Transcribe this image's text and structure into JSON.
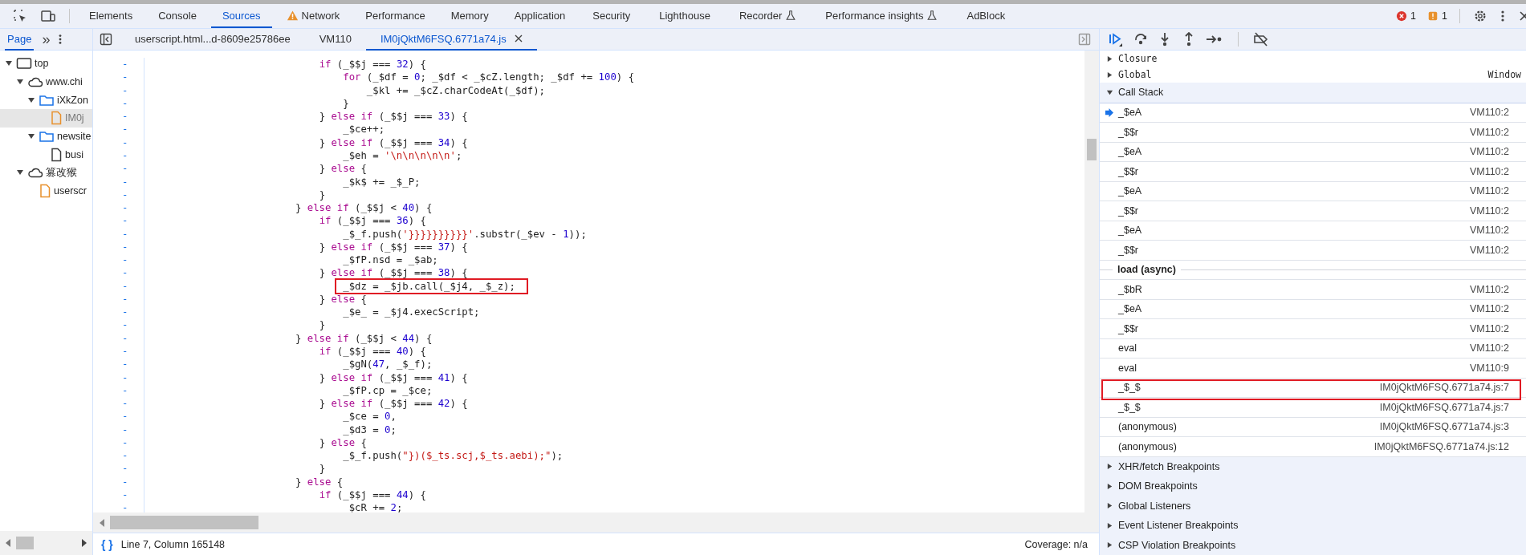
{
  "main_tabs": [
    {
      "label": "Elements",
      "selected": false,
      "kind": "plain"
    },
    {
      "label": "Console",
      "selected": false,
      "kind": "plain"
    },
    {
      "label": "Sources",
      "selected": true,
      "kind": "plain"
    },
    {
      "label": "Network",
      "selected": false,
      "kind": "warning"
    },
    {
      "label": "Performance",
      "selected": false,
      "kind": "plain"
    },
    {
      "label": "Memory",
      "selected": false,
      "kind": "plain"
    },
    {
      "label": "Application",
      "selected": false,
      "kind": "plain"
    },
    {
      "label": "Security",
      "selected": false,
      "kind": "plain"
    },
    {
      "label": "Lighthouse",
      "selected": false,
      "kind": "plain"
    },
    {
      "label": "Recorder",
      "selected": false,
      "kind": "experimental"
    },
    {
      "label": "Performance insights",
      "selected": false,
      "kind": "experimental"
    },
    {
      "label": "AdBlock",
      "selected": false,
      "kind": "plain"
    }
  ],
  "issues": {
    "errors": "1",
    "warnings": "1"
  },
  "navigator": {
    "tab": "Page",
    "more": "»",
    "tree": [
      {
        "label": "top",
        "kind": "frame",
        "expanded": true,
        "selected": false,
        "children": [
          {
            "label": "www.chi",
            "kind": "domain",
            "expanded": true,
            "selected": false,
            "children": [
              {
                "label": "iXkZon",
                "kind": "folder",
                "expanded": true,
                "selected": false,
                "children": [
                  {
                    "label": "IM0j",
                    "kind": "script",
                    "selected": true
                  }
                ]
              },
              {
                "label": "newsite",
                "kind": "folder",
                "expanded": true,
                "selected": false,
                "children": [
                  {
                    "label": "busi",
                    "kind": "document",
                    "selected": false
                  }
                ]
              }
            ]
          },
          {
            "label": "篡改猴",
            "kind": "domain",
            "expanded": true,
            "selected": false,
            "children": [
              {
                "label": "userscr",
                "kind": "script",
                "selected": false
              }
            ]
          }
        ]
      }
    ]
  },
  "editor_tabs": [
    {
      "label": "userscript.html...d-8609e25786ee",
      "selected": false
    },
    {
      "label": "VM110",
      "selected": false
    },
    {
      "label": "IM0jQktM6FSQ.6771a74.js",
      "selected": true,
      "closable": true
    }
  ],
  "code_lines": [
    {
      "gutter": "-",
      "code": "    if (_$$j === 32) {"
    },
    {
      "gutter": "-",
      "code": "        for (_$df = 0; _$df < _$cZ.length; _$df += 100) {"
    },
    {
      "gutter": "-",
      "code": "            _$kl += _$cZ.charCodeAt(_$df);"
    },
    {
      "gutter": "-",
      "code": "        }"
    },
    {
      "gutter": "-",
      "code": "    } else if (_$$j === 33) {"
    },
    {
      "gutter": "-",
      "code": "        _$ce++;"
    },
    {
      "gutter": "-",
      "code": "    } else if (_$$j === 34) {"
    },
    {
      "gutter": "-",
      "code": "        _$eh = '\\n\\n\\n\\n\\n';"
    },
    {
      "gutter": "-",
      "code": "    } else {"
    },
    {
      "gutter": "-",
      "code": "        _$k$ += _$_P;"
    },
    {
      "gutter": "-",
      "code": "    }"
    },
    {
      "gutter": "-",
      "code": "} else if (_$$j < 40) {"
    },
    {
      "gutter": "-",
      "code": "    if (_$$j === 36) {"
    },
    {
      "gutter": "-",
      "code": "        _$_f.push('}}}}}}}}}}'.substr(_$ev - 1));"
    },
    {
      "gutter": "-",
      "code": "    } else if (_$$j === 37) {"
    },
    {
      "gutter": "-",
      "code": "        _$fP.nsd = _$ab;"
    },
    {
      "gutter": "-",
      "code": "    } else if (_$$j === 38) {"
    },
    {
      "gutter": "-",
      "code": "        _$dz = _$jb.call(_$j4, _$_z);",
      "annotated": true
    },
    {
      "gutter": "-",
      "code": "    } else {"
    },
    {
      "gutter": "-",
      "code": "        _$e_ = _$j4.execScript;"
    },
    {
      "gutter": "-",
      "code": "    }"
    },
    {
      "gutter": "-",
      "code": "} else if (_$$j < 44) {"
    },
    {
      "gutter": "-",
      "code": "    if (_$$j === 40) {"
    },
    {
      "gutter": "-",
      "code": "        _$gN(47, _$_f);"
    },
    {
      "gutter": "-",
      "code": "    } else if (_$$j === 41) {"
    },
    {
      "gutter": "-",
      "code": "        _$fP.cp = _$ce;"
    },
    {
      "gutter": "-",
      "code": "    } else if (_$$j === 42) {"
    },
    {
      "gutter": "-",
      "code": "        _$ce = 0,"
    },
    {
      "gutter": "-",
      "code": "        _$d3 = 0;"
    },
    {
      "gutter": "-",
      "code": "    } else {"
    },
    {
      "gutter": "-",
      "code": "        _$_f.push(\"})($_ts.scj,$_ts.aebi);\");"
    },
    {
      "gutter": "-",
      "code": "    }"
    },
    {
      "gutter": "-",
      "code": "} else {"
    },
    {
      "gutter": "-",
      "code": "    if (_$$j === 44) {"
    },
    {
      "gutter": "-",
      "code": "        _$cR += 2;"
    }
  ],
  "status_bar": {
    "format_button": "{ }",
    "position": "Line 7, Column 165148",
    "coverage": "Coverage: n/a"
  },
  "scope": [
    {
      "label": "Closure",
      "expanded": false
    },
    {
      "label": "Global",
      "value": "Window",
      "expanded": false
    }
  ],
  "call_stack": {
    "label": "Call Stack",
    "expanded": true,
    "frames": [
      {
        "kind": "frame",
        "name": "_$eA",
        "location": "VM110:2",
        "current": true
      },
      {
        "kind": "frame",
        "name": "_$$r",
        "location": "VM110:2",
        "current": false
      },
      {
        "kind": "frame",
        "name": "_$eA",
        "location": "VM110:2",
        "current": false
      },
      {
        "kind": "frame",
        "name": "_$$r",
        "location": "VM110:2",
        "current": false
      },
      {
        "kind": "frame",
        "name": "_$eA",
        "location": "VM110:2",
        "current": false
      },
      {
        "kind": "frame",
        "name": "_$$r",
        "location": "VM110:2",
        "current": false
      },
      {
        "kind": "frame",
        "name": "_$eA",
        "location": "VM110:2",
        "current": false
      },
      {
        "kind": "frame",
        "name": "_$$r",
        "location": "VM110:2",
        "current": false
      },
      {
        "kind": "async",
        "name": "load (async)"
      },
      {
        "kind": "frame",
        "name": "_$bR",
        "location": "VM110:2",
        "current": false
      },
      {
        "kind": "frame",
        "name": "_$eA",
        "location": "VM110:2",
        "current": false
      },
      {
        "kind": "frame",
        "name": "_$$r",
        "location": "VM110:2",
        "current": false
      },
      {
        "kind": "frame",
        "name": "eval",
        "location": "VM110:2",
        "current": false
      },
      {
        "kind": "frame",
        "name": "eval",
        "location": "VM110:9",
        "current": false
      },
      {
        "kind": "frame",
        "name": "_$_$",
        "location": "IM0jQktM6FSQ.6771a74.js:7",
        "current": false,
        "annotated": true
      },
      {
        "kind": "frame",
        "name": "_$_$",
        "location": "IM0jQktM6FSQ.6771a74.js:7",
        "current": false
      },
      {
        "kind": "frame",
        "name": "(anonymous)",
        "location": "IM0jQktM6FSQ.6771a74.js:3",
        "current": false
      },
      {
        "kind": "frame",
        "name": "(anonymous)",
        "location": "IM0jQktM6FSQ.6771a74.js:12",
        "current": false
      }
    ]
  },
  "breakpoint_sections": [
    {
      "label": "XHR/fetch Breakpoints",
      "expanded": false
    },
    {
      "label": "DOM Breakpoints",
      "expanded": false
    },
    {
      "label": "Global Listeners",
      "expanded": false
    },
    {
      "label": "Event Listener Breakpoints",
      "expanded": false
    },
    {
      "label": "CSP Violation Breakpoints",
      "expanded": false
    }
  ]
}
